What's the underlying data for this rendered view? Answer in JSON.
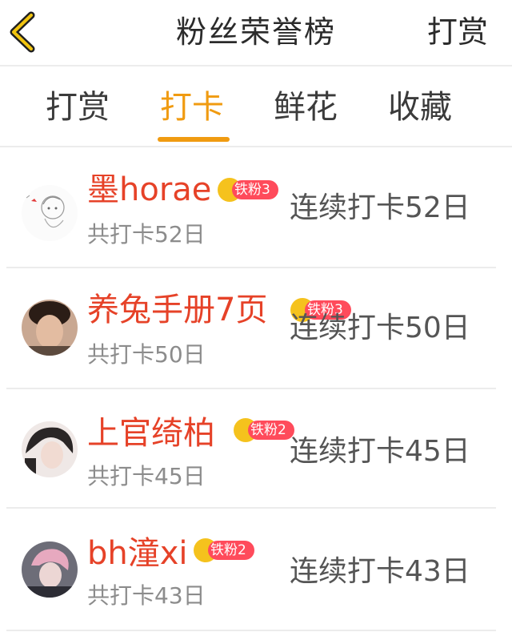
{
  "header": {
    "title": "粉丝荣誉榜",
    "reward_label": "打赏"
  },
  "tabs": [
    {
      "label": "打赏"
    },
    {
      "label": "打卡",
      "active": true
    },
    {
      "label": "鲜花"
    },
    {
      "label": "收藏"
    }
  ],
  "rows": [
    {
      "name": "墨horae",
      "badge": "铁粉3",
      "total": "共打卡52日",
      "streak": "连续打卡52日"
    },
    {
      "name": "养兔手册7页",
      "badge": "铁粉3",
      "total": "共打卡50日",
      "streak": "连续打卡50日"
    },
    {
      "name": "上官绮柏",
      "badge": "铁粉2",
      "total": "共打卡45日",
      "streak": "连续打卡45日"
    },
    {
      "name": "bh潼xi",
      "badge": "铁粉2",
      "total": "共打卡43日",
      "streak": "连续打卡43日"
    }
  ],
  "colors": {
    "accent": "#f09b11",
    "name": "#e64228",
    "badge_pill": "#ff4b5b",
    "badge_crown": "#f5c21d"
  },
  "icons": {
    "back": "chevron-left-icon",
    "crown": "crown-icon"
  }
}
